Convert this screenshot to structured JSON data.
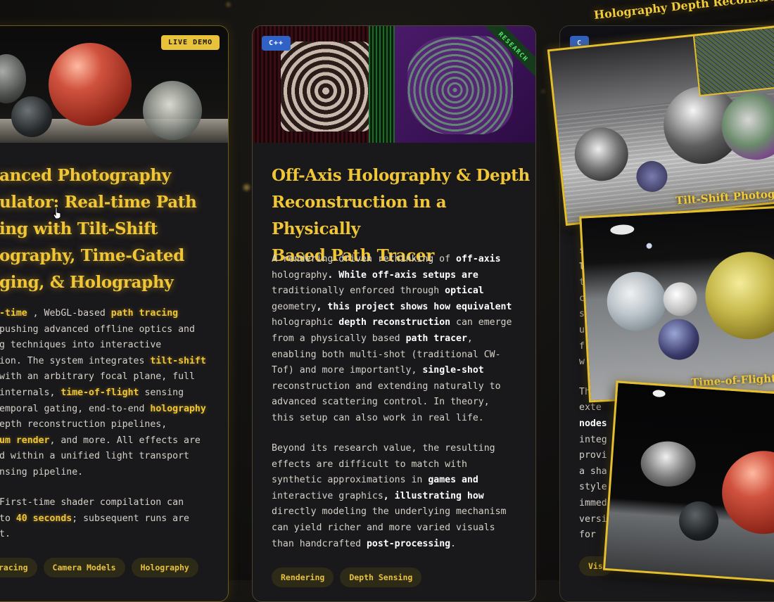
{
  "left_card": {
    "badge": "LIVE DEMO",
    "title_lines": [
      "anced Photography",
      "ulator: Real-time Path",
      "ing with Tilt-Shift",
      "ography, Time-Gated",
      "ging, & Holography"
    ],
    "body": {
      "l1_hl1": "-time",
      "l1_t": " , WebGL-based ",
      "l1_hl2": "path tracing",
      "l2": " pushing advanced offline optics and",
      "l3": "g techniques into interactive",
      "l4_t": "ion. The system integrates ",
      "l4_hl": "tilt-shift",
      "l5": " with an arbitrary focal plane, full",
      "l6_t": " internals, ",
      "l6_hl": "time-of-flight",
      "l6_t2": " sensing",
      "l7_t": "emporal gating, end-to-end ",
      "l7_hl": "holography",
      "l8": "epth reconstruction pipelines,",
      "l9_hl": "um render",
      "l9_t": ", and more. All effects are",
      "l10": "d within a unified light transport",
      "l11": "nsing pipeline."
    },
    "note": {
      "l1": "First-time shader compilation can",
      "l2_t": "to ",
      "l2_hl": "40 seconds",
      "l2_t2": "; subsequent runs are",
      "l3": "t."
    },
    "tags": [
      "racing",
      "Camera Models",
      "Holography"
    ]
  },
  "mid_card": {
    "badge": "C++",
    "ribbon": "RESEARCH",
    "title_lines": [
      "Off-Axis Holography & Depth",
      "Reconstruction in a Physically",
      "Based Path Tracer"
    ],
    "p1": [
      [
        "A rendering-driven rethinking of ",
        "off-axis"
      ],
      [
        "holography",
        ". While off-axis setups are"
      ],
      [
        "traditionally enforced through ",
        "optical"
      ],
      [
        "geometry",
        ", this project shows how equivalent"
      ],
      [
        "holographic ",
        "depth reconstruction",
        " can emerge"
      ],
      [
        "from a physically based ",
        "path tracer",
        ","
      ],
      [
        "enabling both multi-shot (traditional CW-"
      ],
      [
        "Tof) and more importantly, ",
        "single-shot"
      ],
      [
        "reconstruction and extending naturally to"
      ],
      [
        "advanced scattering control. In theory,"
      ],
      [
        "this setup can also work in real life."
      ]
    ],
    "p2": [
      [
        "Beyond its research value, the resulting"
      ],
      [
        "effects are difficult to match with"
      ],
      [
        "synthetic approximations in ",
        "games and"
      ],
      [
        "interactive graphics",
        ", illustrating how"
      ],
      [
        "directly modeling the underlying mechanism"
      ],
      [
        "can yield richer and more varied visuals"
      ],
      [
        "than handcrafted ",
        "post-processing",
        "."
      ]
    ],
    "tags": [
      "Rendering",
      "Depth Sensing"
    ]
  },
  "right_card": {
    "badge": "C",
    "text_frags": [
      "s",
      "l",
      "t",
      "c",
      "s",
      "u",
      "f",
      "w",
      "Th",
      "exte",
      "nodes",
      "integ",
      "provi",
      "a sha",
      "style",
      "immed",
      "versi",
      "for"
    ],
    "tag": "Vis"
  },
  "overlays": {
    "holo_caption": "Holography Depth Reconstruction",
    "tilt_caption": "Tilt-Shift Photogra",
    "tof_caption": "Time-of-Flight"
  },
  "colors": {
    "accent": "#f0c636",
    "card_bg": "#19181b",
    "tag_bg": "#2e2a18"
  },
  "cursor": "pointer-hand-icon"
}
